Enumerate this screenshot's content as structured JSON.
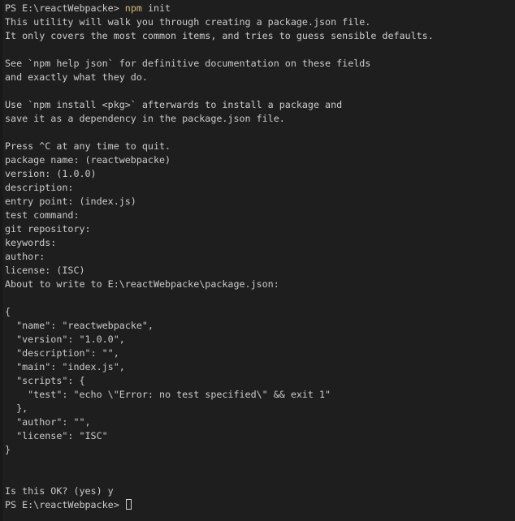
{
  "terminal": {
    "shell": "PowerShell",
    "colors": {
      "background": "#1e1e1e",
      "foreground": "#cccccc",
      "command_highlight": "#d7ba7d",
      "gutter": "#181818",
      "cursor": "#cfcfcf"
    },
    "prompt": {
      "prefix": "PS ",
      "path": "E:\\reactWebpacke",
      "symbol": "> ",
      "full": "PS E:\\reactWebpacke> "
    },
    "command": {
      "name": "npm",
      "args": " init",
      "full": "npm init"
    },
    "lines": [
      {
        "type": "prompt-command",
        "prompt": "PS E:\\reactWebpacke> ",
        "cmd": "npm",
        "args": " init"
      },
      {
        "type": "output",
        "text": "This utility will walk you through creating a package.json file."
      },
      {
        "type": "output",
        "text": "It only covers the most common items, and tries to guess sensible defaults."
      },
      {
        "type": "blank",
        "text": ""
      },
      {
        "type": "output",
        "text": "See `npm help json` for definitive documentation on these fields"
      },
      {
        "type": "output",
        "text": "and exactly what they do."
      },
      {
        "type": "blank",
        "text": ""
      },
      {
        "type": "output",
        "text": "Use `npm install <pkg>` afterwards to install a package and"
      },
      {
        "type": "output",
        "text": "save it as a dependency in the package.json file."
      },
      {
        "type": "blank",
        "text": ""
      },
      {
        "type": "output",
        "text": "Press ^C at any time to quit."
      },
      {
        "type": "output",
        "text": "package name: (reactwebpacke)"
      },
      {
        "type": "output",
        "text": "version: (1.0.0)"
      },
      {
        "type": "output",
        "text": "description:"
      },
      {
        "type": "output",
        "text": "entry point: (index.js)"
      },
      {
        "type": "output",
        "text": "test command:"
      },
      {
        "type": "output",
        "text": "git repository:"
      },
      {
        "type": "output",
        "text": "keywords:"
      },
      {
        "type": "output",
        "text": "author:"
      },
      {
        "type": "output",
        "text": "license: (ISC)"
      },
      {
        "type": "output",
        "text": "About to write to E:\\reactWebpacke\\package.json:"
      },
      {
        "type": "blank",
        "text": ""
      },
      {
        "type": "output",
        "text": "{"
      },
      {
        "type": "output",
        "text": "  \"name\": \"reactwebpacke\","
      },
      {
        "type": "output",
        "text": "  \"version\": \"1.0.0\","
      },
      {
        "type": "output",
        "text": "  \"description\": \"\","
      },
      {
        "type": "output",
        "text": "  \"main\": \"index.js\","
      },
      {
        "type": "output",
        "text": "  \"scripts\": {"
      },
      {
        "type": "output",
        "text": "    \"test\": \"echo \\\"Error: no test specified\\\" && exit 1\""
      },
      {
        "type": "output",
        "text": "  },"
      },
      {
        "type": "output",
        "text": "  \"author\": \"\","
      },
      {
        "type": "output",
        "text": "  \"license\": \"ISC\""
      },
      {
        "type": "output",
        "text": "}"
      },
      {
        "type": "blank",
        "text": ""
      },
      {
        "type": "blank",
        "text": ""
      },
      {
        "type": "output",
        "text": "Is this OK? (yes) y"
      },
      {
        "type": "prompt-cursor",
        "prompt": "PS E:\\reactWebpacke> "
      }
    ],
    "package_json": {
      "name": "reactwebpacke",
      "version": "1.0.0",
      "description": "",
      "main": "index.js",
      "scripts": {
        "test": "echo \\\"Error: no test specified\\\" && exit 1"
      },
      "author": "",
      "license": "ISC"
    },
    "prompts_answered": {
      "package_name_default": "(reactwebpacke)",
      "version_default": "(1.0.0)",
      "description": "",
      "entry_point_default": "(index.js)",
      "test_command": "",
      "git_repository": "",
      "keywords": "",
      "author": "",
      "license_default": "(ISC)",
      "confirm_question": "Is this OK? (yes)",
      "confirm_answer": "y"
    },
    "write_target": "E:\\reactWebpacke\\package.json"
  }
}
